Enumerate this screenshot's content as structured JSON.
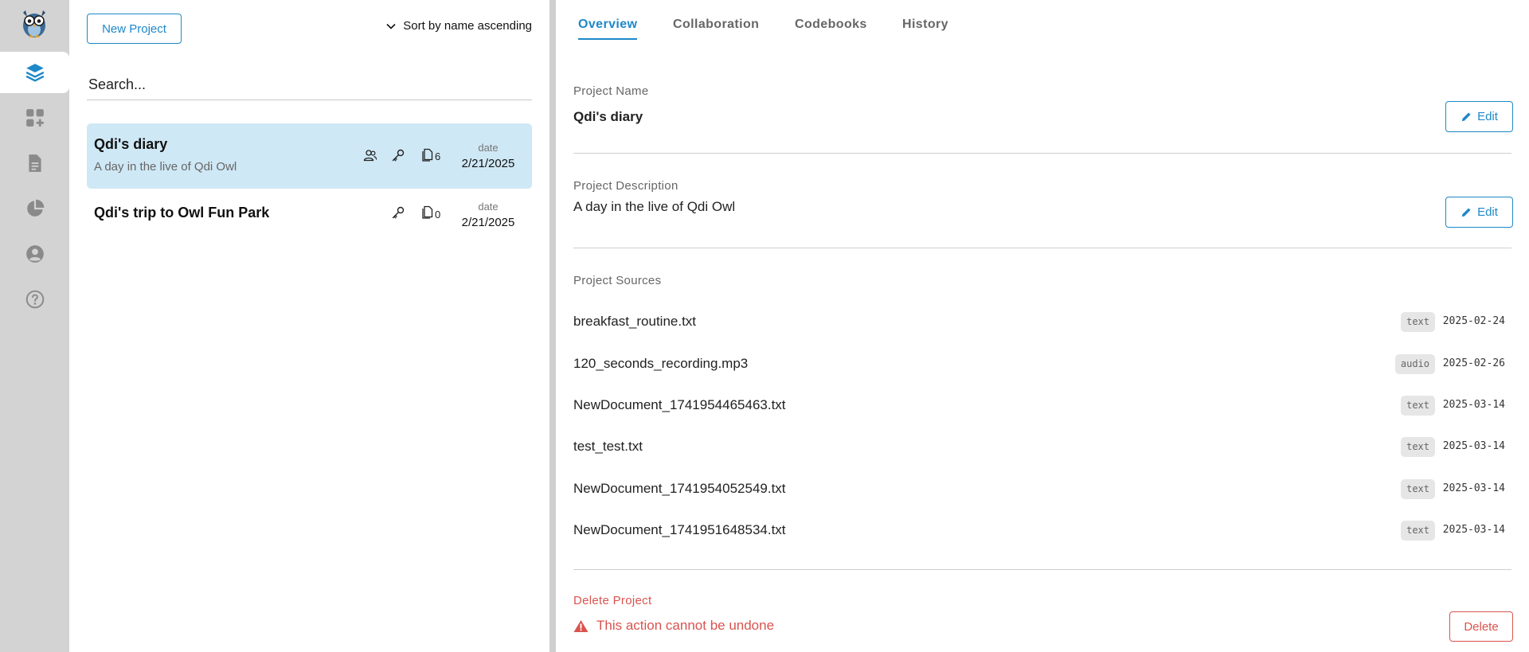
{
  "sidebar": {
    "items": [
      {
        "name": "projects",
        "icon": "layers-icon",
        "active": true
      },
      {
        "name": "components",
        "icon": "grid-plus-icon",
        "active": false
      },
      {
        "name": "sources",
        "icon": "document-icon",
        "active": false
      },
      {
        "name": "analysis",
        "icon": "pie-chart-icon",
        "active": false
      },
      {
        "name": "account",
        "icon": "user-circle-icon",
        "active": false
      },
      {
        "name": "help",
        "icon": "help-circle-icon",
        "active": false
      }
    ]
  },
  "list": {
    "new_project_label": "New Project",
    "sort_label": "Sort by name ascending",
    "search_placeholder": "Search...",
    "projects": [
      {
        "title": "Qdi's diary",
        "description": "A day in the live of Qdi Owl",
        "doc_count": "6",
        "date_label": "date",
        "date": "2/21/2025",
        "selected": true,
        "shared": true
      },
      {
        "title": "Qdi's trip to Owl Fun Park",
        "description": "",
        "doc_count": "0",
        "date_label": "date",
        "date": "2/21/2025",
        "selected": false,
        "shared": false
      }
    ]
  },
  "detail": {
    "tabs": [
      "Overview",
      "Collaboration",
      "Codebooks",
      "History"
    ],
    "active_tab": "Overview",
    "name_label": "Project Name",
    "name_value": "Qdi's diary",
    "description_label": "Project Description",
    "description_value": "A day in the live of Qdi Owl",
    "edit_label": "Edit",
    "sources_label": "Project Sources",
    "sources": [
      {
        "name": "breakfast_routine.txt",
        "type": "text",
        "date": "2025-02-24"
      },
      {
        "name": "120_seconds_recording.mp3",
        "type": "audio",
        "date": "2025-02-26"
      },
      {
        "name": "NewDocument_1741954465463.txt",
        "type": "text",
        "date": "2025-03-14"
      },
      {
        "name": "test_test.txt",
        "type": "text",
        "date": "2025-03-14"
      },
      {
        "name": "NewDocument_1741954052549.txt",
        "type": "text",
        "date": "2025-03-14"
      },
      {
        "name": "NewDocument_1741951648534.txt",
        "type": "text",
        "date": "2025-03-14"
      }
    ],
    "delete_label": "Delete Project",
    "delete_warning": "This action cannot be undone",
    "delete_button": "Delete"
  },
  "colors": {
    "accent": "#1e88c8",
    "danger": "#d9534f",
    "selected_card": "#cfe8f5",
    "sidebar": "#d3d3d3"
  }
}
